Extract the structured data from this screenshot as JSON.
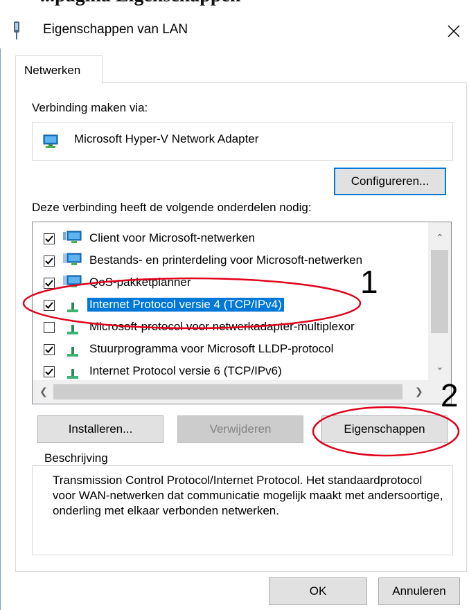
{
  "window": {
    "title": "Eigenschappen van LAN",
    "clipped_heading": "...pagina Eigenschappen"
  },
  "tabs": [
    {
      "label": "Netwerken",
      "active": true
    }
  ],
  "connect_label": "Verbinding maken via:",
  "adapter": {
    "name": "Microsoft Hyper-V Network Adapter",
    "icon": "network-adapter-icon"
  },
  "buttons": {
    "configure": "Configureren...",
    "install": "Installeren...",
    "remove": "Verwijderen",
    "properties": "Eigenschappen",
    "ok": "OK",
    "cancel": "Annuleren"
  },
  "components_label": "Deze verbinding heeft de volgende onderdelen nodig:",
  "components": [
    {
      "label": "Client voor Microsoft-netwerken",
      "checked": true,
      "icon": "network-client-icon"
    },
    {
      "label": "Bestands- en printerdeling voor Microsoft-netwerken",
      "checked": true,
      "icon": "file-printer-sharing-icon"
    },
    {
      "label": "QoS-pakketplanner",
      "checked": true,
      "icon": "qos-service-icon"
    },
    {
      "label": "Internet Protocol versie 4 (TCP/IPv4)",
      "checked": true,
      "selected": true,
      "icon": "protocol-icon"
    },
    {
      "label": "Microsoft-protocol voor netwerkadapter-multiplexor",
      "checked": false,
      "icon": "protocol-icon"
    },
    {
      "label": "Stuurprogramma voor Microsoft LLDP-protocol",
      "checked": true,
      "icon": "protocol-icon"
    },
    {
      "label": "Internet Protocol versie 6 (TCP/IPv6)",
      "checked": true,
      "icon": "protocol-icon"
    }
  ],
  "description": {
    "legend": "Beschrijving",
    "text": "Transmission Control Protocol/Internet Protocol. Het standaardprotocol voor WAN-netwerken dat communicatie mogelijk maakt met andersoortige, onderling met elkaar verbonden netwerken."
  },
  "annotations": [
    {
      "number": "1",
      "target": "Internet Protocol versie 4 (TCP/IPv4)"
    },
    {
      "number": "2",
      "target": "Eigenschappen"
    }
  ],
  "colors": {
    "highlight": "#0078d7",
    "annotation": "#e0001b",
    "frame": "#7a9bc4"
  }
}
